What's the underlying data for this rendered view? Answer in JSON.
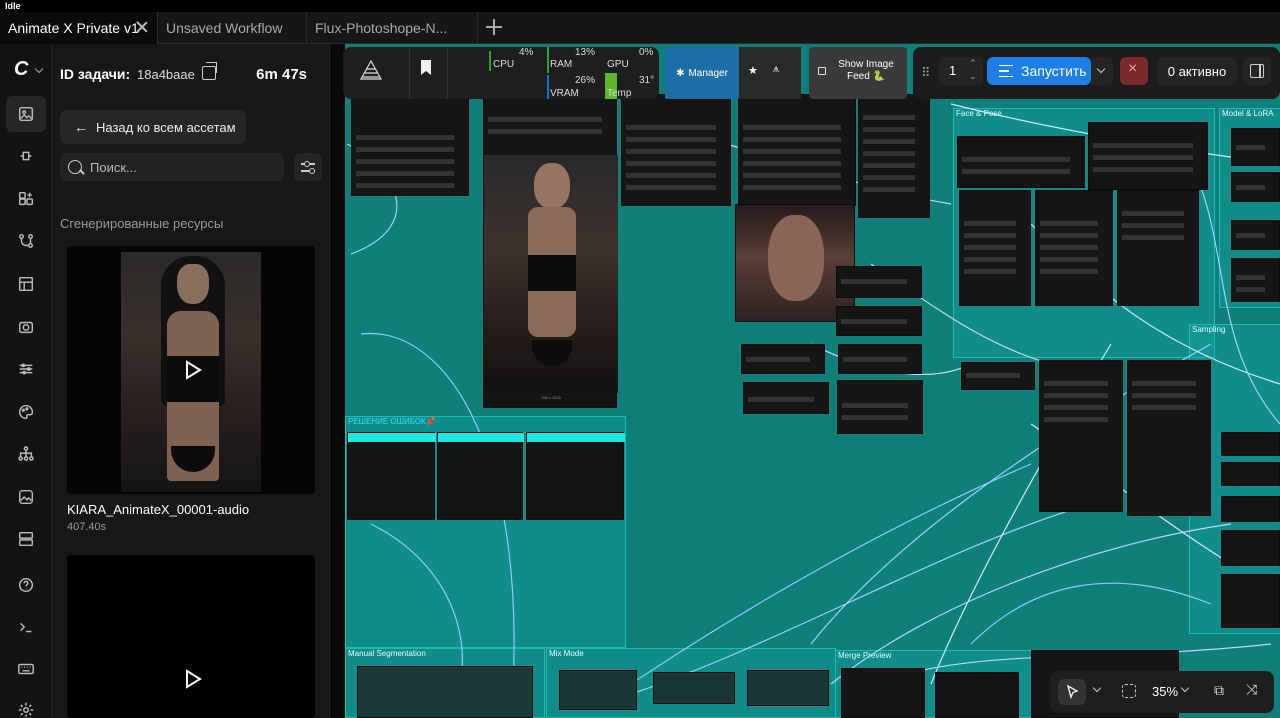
{
  "window": {
    "status": "Idle"
  },
  "tabs": [
    {
      "label": "Animate X Private v1",
      "active": true
    },
    {
      "label": "Unsaved Workflow",
      "active": false
    },
    {
      "label": "Flux-Photoshope-N...",
      "active": false
    }
  ],
  "rail": {
    "logo": "C",
    "items": [
      "images-icon",
      "plug-icon",
      "sparkles-icon",
      "branch-icon",
      "layout-icon",
      "camera-icon",
      "sliders-icon",
      "palette-icon",
      "hierarchy-icon",
      "image-icon",
      "template-icon",
      "help-icon",
      "terminal-icon",
      "keyboard-icon",
      "settings-icon"
    ]
  },
  "panel": {
    "task_label": "ID задачи:",
    "task_id": "18a4baae",
    "elapsed": "6m 47s",
    "back_label": "Назад ко всем ассетам",
    "search_placeholder": "Поиск...",
    "section_title": "Сгенерированные ресурсы",
    "assets": [
      {
        "name": "KIARA_AnimateX_00001-audio",
        "meta": "407.40s"
      },
      {
        "name": "",
        "meta": ""
      }
    ]
  },
  "toolbar": {
    "resources": [
      {
        "label": "CPU",
        "value": "4%",
        "color": "#2aa82a"
      },
      {
        "label": "RAM",
        "value": "13%",
        "color": "#2aa82a"
      },
      {
        "label": "GPU",
        "value": "0%",
        "color": "#2aa82a"
      },
      {
        "label": "VRAM",
        "value": "26%",
        "color": "#1e6bd6"
      },
      {
        "label": "Temp",
        "value": "31°",
        "color": "#5ab82a"
      }
    ],
    "manager_label": "Manager",
    "image_feed_label": "Show Image Feed 🐍",
    "queue_count": "1",
    "run_label": "Запустить",
    "active_label": "0 активно"
  },
  "canvas": {
    "groups": [
      {
        "label": "Face & Pose"
      },
      {
        "label": "Model & LoRA"
      },
      {
        "label": "Sampling"
      },
      {
        "label": "РЕШЕНИЕ ОШИБОК📌"
      },
      {
        "label": "Manual Segmentation"
      },
      {
        "label": "Mix Mode"
      },
      {
        "label": "Merge Preview"
      }
    ],
    "preview_caption": "768 x 1216"
  },
  "bottom_tools": {
    "zoom": "35%"
  },
  "colors": {
    "canvas": "#0f7f7a",
    "accent": "#1d7fe6",
    "danger": "#8a2a2a"
  }
}
